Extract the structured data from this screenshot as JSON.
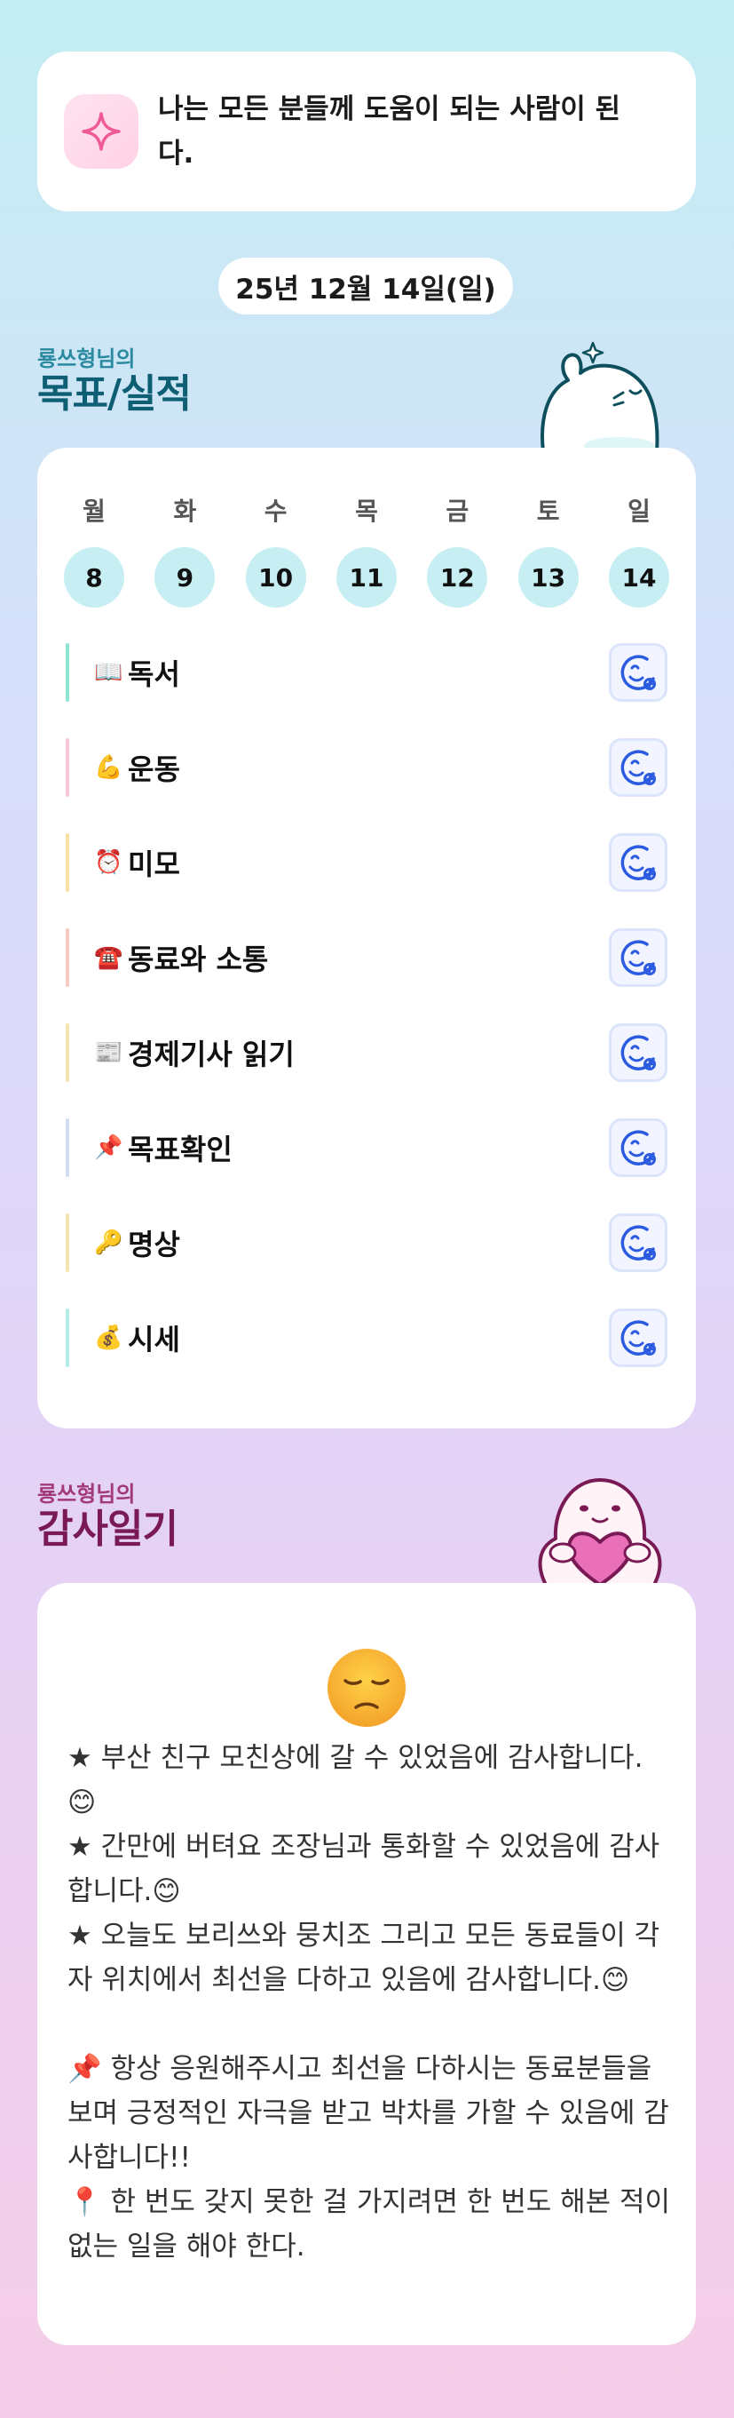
{
  "motto": {
    "icon": "sparkle-icon",
    "text": "나는 모든 분들께 도움이 되는 사람이 된다."
  },
  "date": "25년 12월 14일(일)",
  "goals_section": {
    "subtitle": "룡쓰형님의",
    "title": "목표/실적"
  },
  "week": [
    {
      "day": "월",
      "date": "8"
    },
    {
      "day": "화",
      "date": "9"
    },
    {
      "day": "수",
      "date": "10"
    },
    {
      "day": "목",
      "date": "11"
    },
    {
      "day": "금",
      "date": "12"
    },
    {
      "day": "토",
      "date": "13"
    },
    {
      "day": "일",
      "date": "14"
    }
  ],
  "goals": [
    {
      "emoji": "📖",
      "label": "독서",
      "color": "#8ee5d2"
    },
    {
      "emoji": "💪",
      "label": "운동",
      "color": "#f8c6d8"
    },
    {
      "emoji": "⏰",
      "label": "미모",
      "color": "#f7e3a8"
    },
    {
      "emoji": "☎️",
      "label": "동료와 소통",
      "color": "#f8c9c2"
    },
    {
      "emoji": "📰",
      "label": "경제기사 읽기",
      "color": "#f5e4b0"
    },
    {
      "emoji": "📌",
      "label": "목표확인",
      "color": "#d3dcf0"
    },
    {
      "emoji": "🔑",
      "label": "명상",
      "color": "#f5e4b0"
    },
    {
      "emoji": "💰",
      "label": "시세",
      "color": "#b2ece4"
    }
  ],
  "thanks_section": {
    "subtitle": "룡쓰형님의",
    "title": "감사일기",
    "mood_emoji": "pensive-face-icon",
    "body": "★ 부산 친구 모친상에 갈 수 있었음에 감사합니다.😊\n★ 간만에 버텨요 조장님과 통화할 수 있었음에 감사합니다.😊\n★ 오늘도 보리쓰와 뭉치조 그리고 모든 동료들이 각자 위치에서 최선을 다하고 있음에 감사합니다.😊\n\n📌 항상 응원해주시고 최선을 다하시는 동료분들을 보며 긍정적인 자극을 받고 박차를 가할 수 있음에 감사합니다!!\n📍 한 번도 갖지 못한 걸 가지려면 한 번도 해본 적이 없는 일을 해야 한다."
  },
  "colors": {
    "accent_teal": "#0e5f73",
    "accent_plum": "#7a1a55",
    "day_circle": "#c6eef3",
    "check_button": "#2b5be0"
  }
}
